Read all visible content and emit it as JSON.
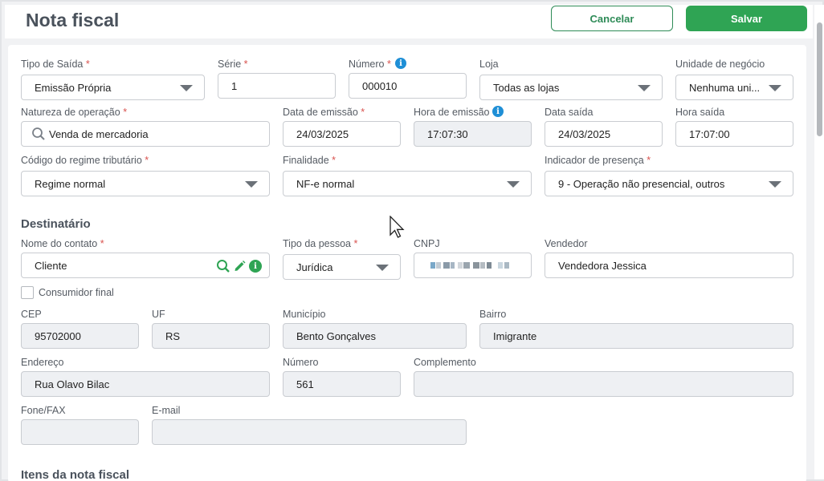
{
  "header": {
    "title": "Nota fiscal",
    "cancel_label": "Cancelar",
    "save_label": "Salvar"
  },
  "required_mark": "*",
  "info_glyph": "i",
  "form": {
    "tipo_saida": {
      "label": "Tipo de Saída",
      "value": "Emissão Própria"
    },
    "serie": {
      "label": "Série",
      "value": "1"
    },
    "numero": {
      "label": "Número",
      "value": "000010"
    },
    "loja": {
      "label": "Loja",
      "value": "Todas as lojas"
    },
    "unidade_negocio": {
      "label": "Unidade de negócio",
      "value": "Nenhuma uni..."
    },
    "natureza": {
      "label": "Natureza de operação",
      "value": "Venda de mercadoria"
    },
    "data_emissao": {
      "label": "Data de emissão",
      "value": "24/03/2025"
    },
    "hora_emissao": {
      "label": "Hora de emissão",
      "value": "17:07:30"
    },
    "data_saida": {
      "label": "Data saída",
      "value": "24/03/2025"
    },
    "hora_saida": {
      "label": "Hora saída",
      "value": "17:07:00"
    },
    "regime": {
      "label": "Código do regime tributário",
      "value": "Regime normal"
    },
    "finalidade": {
      "label": "Finalidade",
      "value": "NF-e normal"
    },
    "presenca": {
      "label": "Indicador de presença",
      "value": "9 - Operação não presencial, outros"
    }
  },
  "destinatario": {
    "title": "Destinatário",
    "nome_contato": {
      "label": "Nome do contato",
      "value": "Cliente"
    },
    "tipo_pessoa": {
      "label": "Tipo da pessoa",
      "value": "Jurídica"
    },
    "cnpj": {
      "label": "CNPJ"
    },
    "vendedor": {
      "label": "Vendedor",
      "value": "Vendedora Jessica"
    },
    "consumidor_final": {
      "label": "Consumidor final"
    },
    "cep": {
      "label": "CEP",
      "value": "95702000"
    },
    "uf": {
      "label": "UF",
      "value": "RS"
    },
    "municipio": {
      "label": "Município",
      "value": "Bento Gonçalves"
    },
    "bairro": {
      "label": "Bairro",
      "value": "Imigrante"
    },
    "endereco": {
      "label": "Endereço",
      "value": "Rua Olavo Bilac"
    },
    "numero": {
      "label": "Número",
      "value": "561"
    },
    "complemento": {
      "label": "Complemento",
      "value": ""
    },
    "fone": {
      "label": "Fone/FAX",
      "value": ""
    },
    "email": {
      "label": "E-mail",
      "value": ""
    }
  },
  "itens": {
    "title": "Itens da nota fiscal"
  },
  "colors": {
    "accent": "#2fa454",
    "info": "#1f8fd6",
    "required": "#d9534f"
  }
}
